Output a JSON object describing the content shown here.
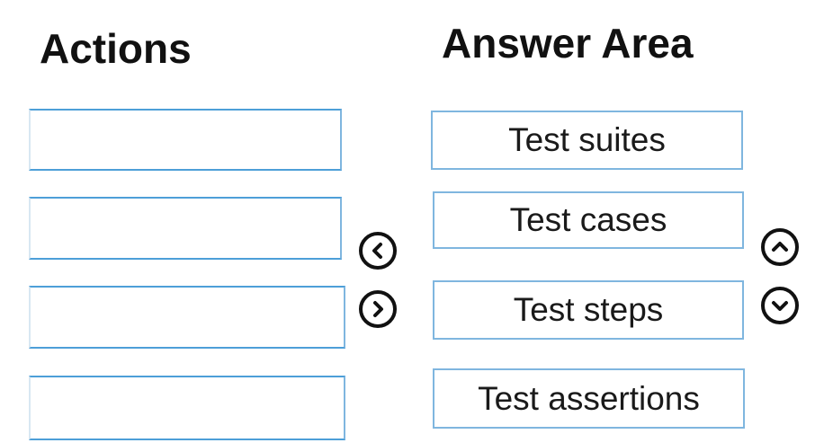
{
  "actions": {
    "heading": "Actions",
    "slots": [
      "",
      "",
      "",
      ""
    ]
  },
  "answer_area": {
    "heading": "Answer Area",
    "items": [
      {
        "label": "Test suites"
      },
      {
        "label": "Test cases"
      },
      {
        "label": "Test steps"
      },
      {
        "label": "Test assertions"
      }
    ]
  },
  "controls": {
    "move_left_icon": "chevron-left-circle",
    "move_right_icon": "chevron-right-circle",
    "move_up_icon": "chevron-up-circle",
    "move_down_icon": "chevron-down-circle"
  }
}
